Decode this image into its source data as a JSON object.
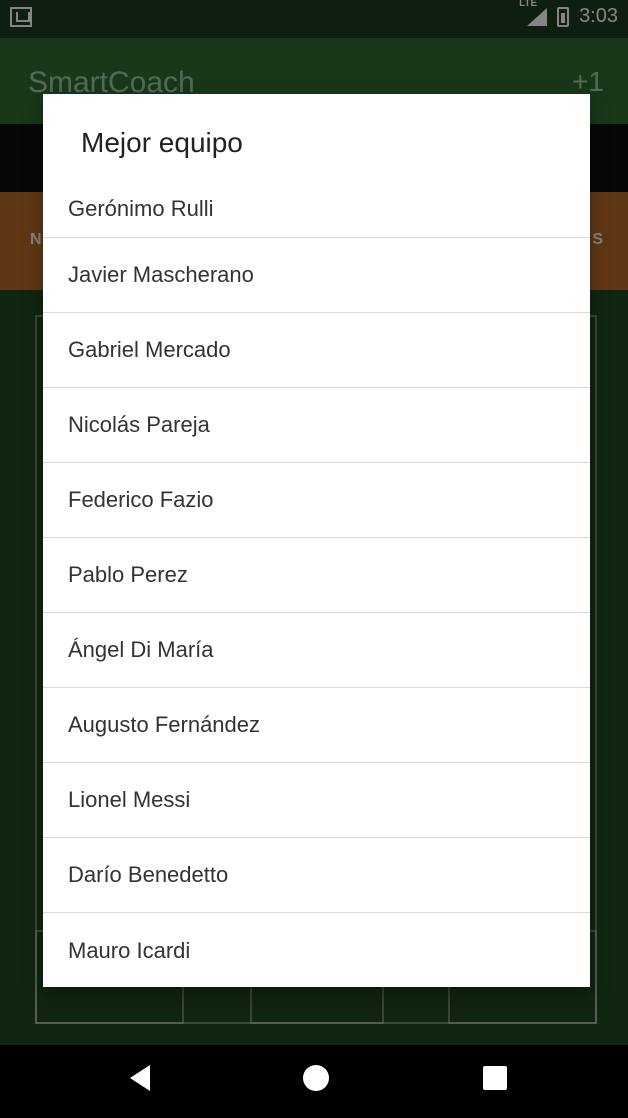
{
  "status_bar": {
    "network_label": "LTE",
    "time": "3:03",
    "icons": [
      "email-icon",
      "signal-icon",
      "battery-icon"
    ]
  },
  "toolbar": {
    "title": "SmartCoach",
    "action": "+1"
  },
  "background": {
    "orange_left": "N",
    "orange_right": "S"
  },
  "dialog": {
    "title": "Mejor equipo",
    "players": [
      "Gerónimo Rulli",
      "Javier Mascherano",
      "Gabriel Mercado",
      "Nicolás Pareja",
      "Federico Fazio",
      "Pablo Perez",
      "Ángel Di María",
      "Augusto Fernández",
      "Lionel Messi",
      "Darío Benedetto",
      "Mauro Icardi"
    ]
  },
  "navigation": {
    "buttons": [
      "back-icon",
      "home-icon",
      "recent-apps-icon"
    ]
  },
  "colors": {
    "status_bar": "#1b3a1f",
    "toolbar": "#2f6b31",
    "orange": "#b86a2a",
    "field": "#204a20"
  }
}
